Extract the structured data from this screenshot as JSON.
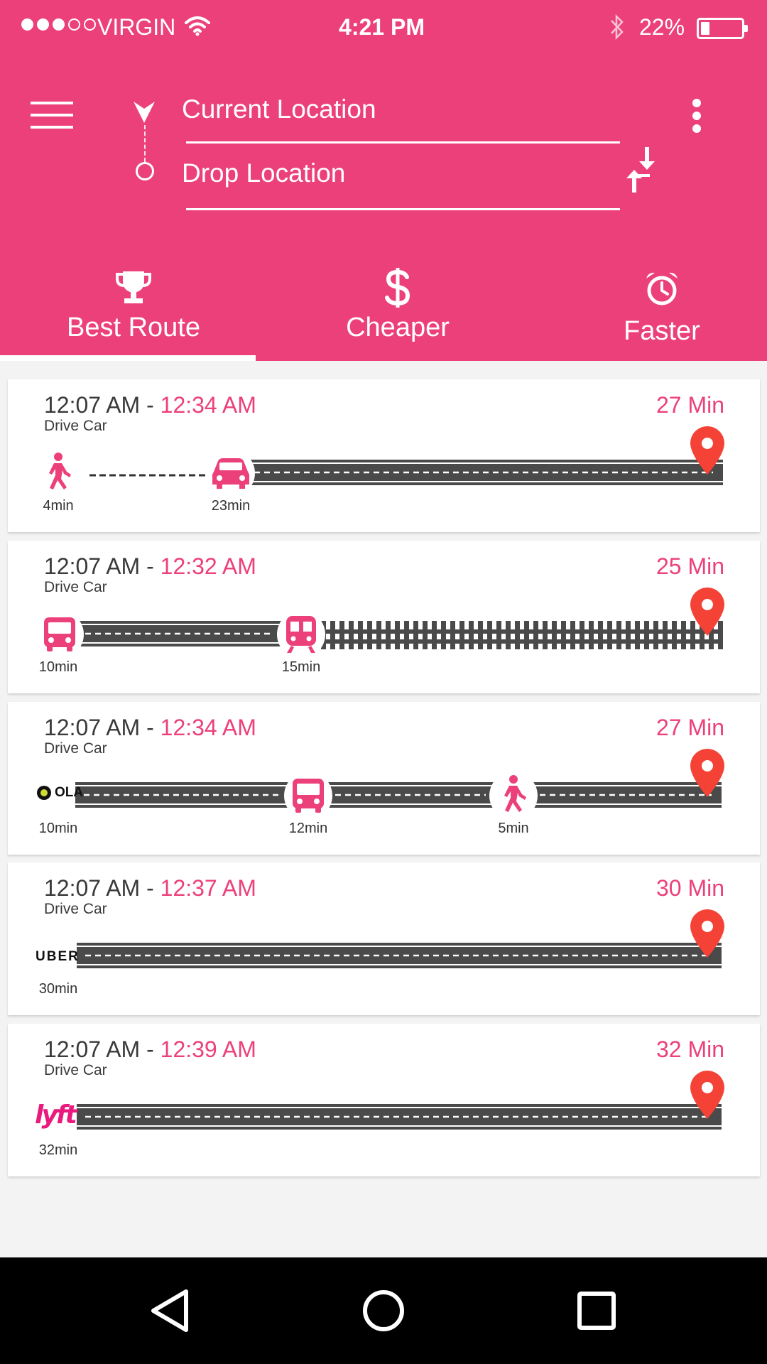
{
  "status_bar": {
    "carrier": "VIRGIN",
    "time": "4:21 PM",
    "battery": "22%",
    "battery_level": 0.22,
    "signal_bars": 3,
    "signal_total": 5,
    "icons": [
      "wifi-icon",
      "bluetooth-icon",
      "battery-icon"
    ]
  },
  "header": {
    "from_location": "Current Location",
    "to_location": "Drop Location",
    "icons": [
      "menu-icon",
      "navigation-arrow-icon",
      "more-vertical-icon",
      "swap-vertical-icon"
    ]
  },
  "tabs": [
    {
      "label": "Best Route",
      "icon": "trophy-icon",
      "selected": true
    },
    {
      "label": "Cheaper",
      "icon": "dollar-icon",
      "selected": false
    },
    {
      "label": "Faster",
      "icon": "alarm-clock-icon",
      "selected": false
    }
  ],
  "routes": [
    {
      "depart": "12:07 AM",
      "separator": " - ",
      "arrive": "12:34 AM",
      "mode": "Drive Car",
      "duration": "27 Min",
      "segments": [
        {
          "type": "walk",
          "icon": "walking-person-icon",
          "time": "4min"
        },
        {
          "type": "car",
          "icon": "car-icon",
          "time": "23min"
        }
      ]
    },
    {
      "depart": "12:07 AM",
      "separator": " - ",
      "arrive": "12:32 AM",
      "mode": "Drive Car",
      "duration": "25 Min",
      "segments": [
        {
          "type": "bus",
          "icon": "bus-icon",
          "time": "10min"
        },
        {
          "type": "train",
          "icon": "train-icon",
          "time": "15min"
        }
      ]
    },
    {
      "depart": "12:07 AM",
      "separator": " - ",
      "arrive": "12:34 AM",
      "mode": "Drive Car",
      "duration": "27 Min",
      "segments": [
        {
          "type": "ola",
          "icon": "ola-logo",
          "logo_text": "OLA",
          "time": "10min"
        },
        {
          "type": "bus",
          "icon": "bus-icon",
          "time": "12min"
        },
        {
          "type": "walk",
          "icon": "walking-person-icon",
          "time": "5min"
        }
      ]
    },
    {
      "depart": "12:07 AM",
      "separator": " - ",
      "arrive": "12:37 AM",
      "mode": "Drive Car",
      "duration": "30 Min",
      "segments": [
        {
          "type": "uber",
          "icon": "uber-logo",
          "logo_text": "UBER",
          "time": "30min"
        }
      ]
    },
    {
      "depart": "12:07 AM",
      "separator": " - ",
      "arrive": "12:39 AM",
      "mode": "Drive Car",
      "duration": "32 Min",
      "segments": [
        {
          "type": "lyft",
          "icon": "lyft-logo",
          "logo_text": "lyft",
          "time": "32min"
        }
      ]
    }
  ],
  "nav_bar": {
    "icons": [
      "back-icon",
      "home-icon",
      "recents-icon"
    ]
  },
  "colors": {
    "primary": "#ec407a",
    "pin": "#f44336",
    "road": "#4a4a4a",
    "text": "#3a3a3a"
  }
}
